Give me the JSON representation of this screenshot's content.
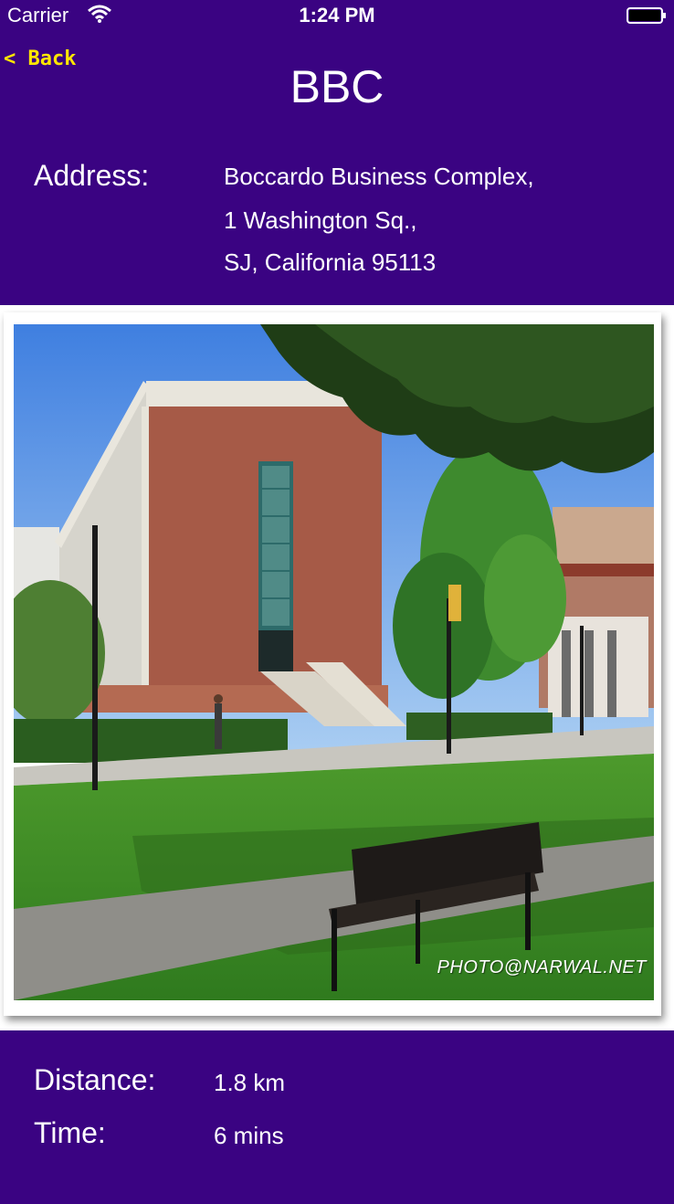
{
  "status_bar": {
    "carrier": "Carrier",
    "time": "1:24 PM"
  },
  "nav": {
    "back_label": "< Back",
    "title": "BBC"
  },
  "address": {
    "label": "Address:",
    "lines": [
      "Boccardo Business Complex,",
      "1 Washington Sq.,",
      "SJ, California 95113"
    ]
  },
  "photo": {
    "watermark": "PHOTO@NARWAL.NET"
  },
  "info": {
    "distance_label": "Distance:",
    "distance_value": "1.8 km",
    "time_label": "Time:",
    "time_value": "6 mins"
  },
  "colors": {
    "header_bg": "#3a0382",
    "back_text": "#ffe600",
    "text": "#ffffff"
  },
  "icons": [
    "wifi-icon",
    "battery-icon"
  ]
}
